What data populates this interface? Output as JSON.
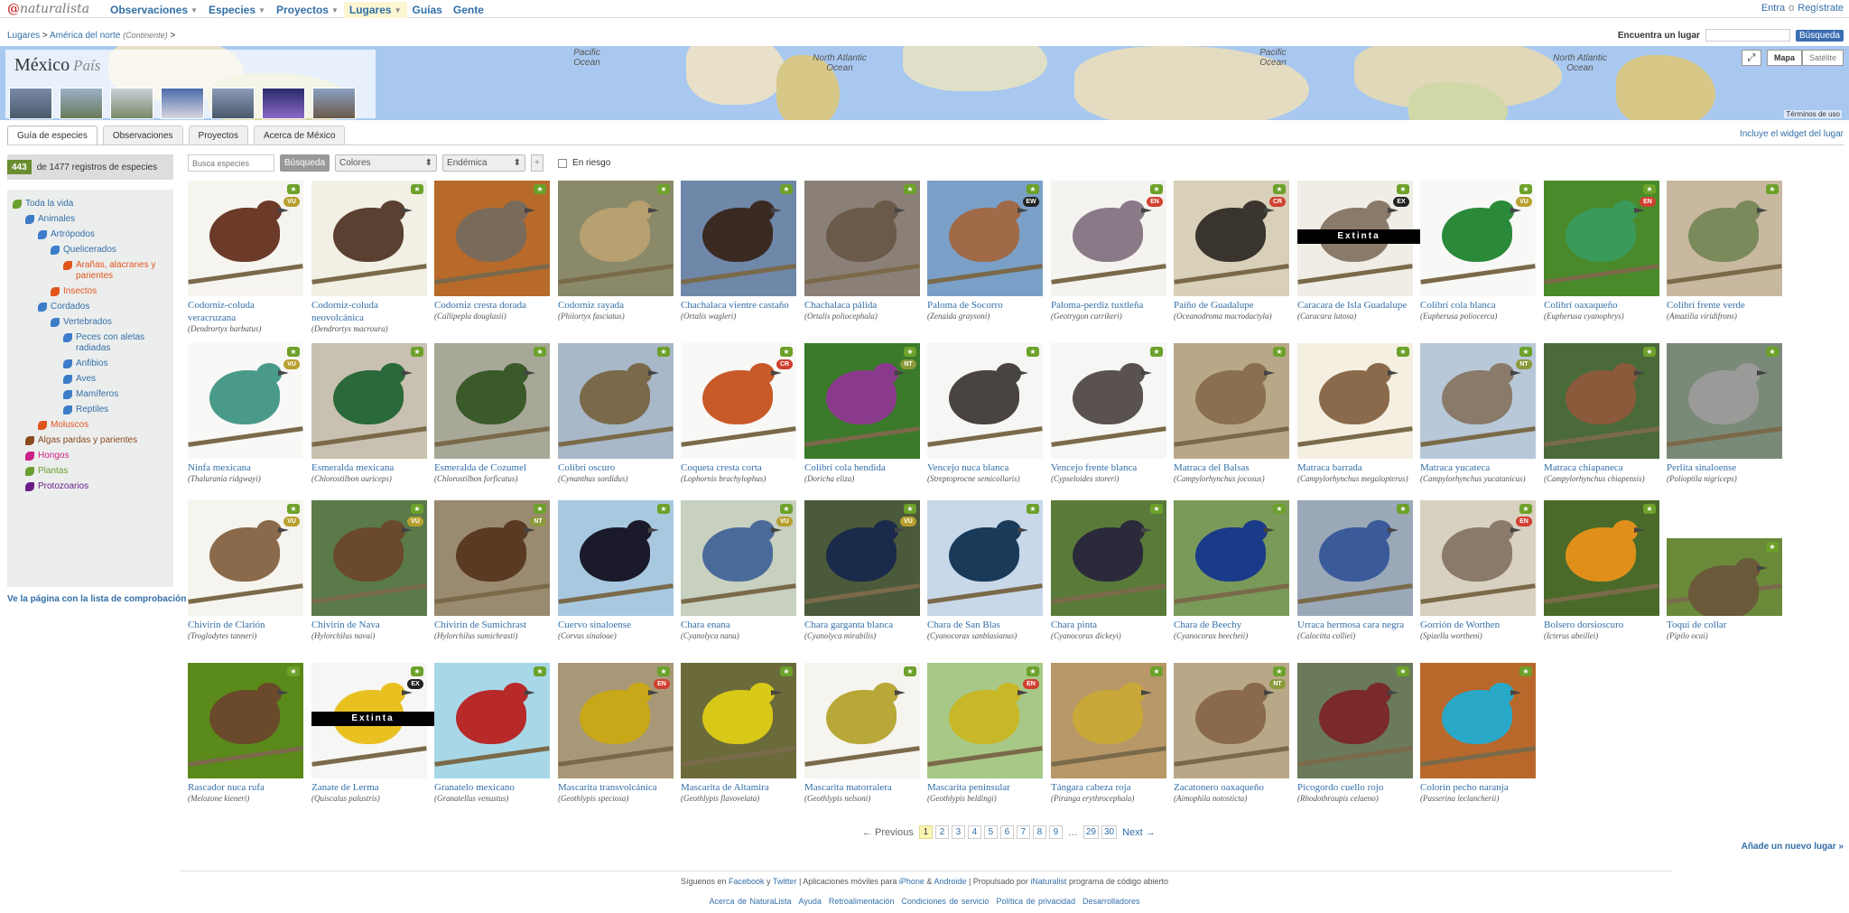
{
  "brand": {
    "logo_text": "naturalista",
    "logo_mark": "@"
  },
  "nav": {
    "items": [
      {
        "label": "Observaciones",
        "dropdown": true
      },
      {
        "label": "Especies",
        "dropdown": true
      },
      {
        "label": "Proyectos",
        "dropdown": true
      },
      {
        "label": "Lugares",
        "dropdown": true,
        "active": true
      },
      {
        "label": "Guías",
        "dropdown": false
      },
      {
        "label": "Gente",
        "dropdown": false
      }
    ]
  },
  "auth": {
    "login": "Entra",
    "or": "o",
    "signup": "Regístrate"
  },
  "breadcrumb": {
    "root": "Lugares",
    "sep": ">",
    "parent": "América del norte",
    "parent_type": "(Continente)"
  },
  "find_place": {
    "label": "Encuentra un lugar",
    "button": "Búsqueda"
  },
  "place": {
    "name": "México",
    "type": "País"
  },
  "map": {
    "oceans": [
      "Pacific Ocean",
      "North Atlantic Ocean",
      "Pacific Ocean",
      "North Atlantic Ocean"
    ],
    "mode_map": "Mapa",
    "mode_sat": "Satélite",
    "terms": "Términos de uso"
  },
  "tabs": [
    "Guía de especies",
    "Observaciones",
    "Proyectos",
    "Acerca de México"
  ],
  "widget_link": "Incluye el widget del lugar",
  "count": {
    "number": "443",
    "text": "de 1477 registros de especies"
  },
  "filters": {
    "search_placeholder": "Busca especies",
    "search_button": "Búsqueda",
    "colors": "Colores",
    "endemic": "Endémica",
    "plus": "+",
    "at_risk": "En riesgo"
  },
  "taxa_tree": [
    {
      "label": "Toda la vida",
      "color": "#6a9e2f",
      "depth": 0
    },
    {
      "label": "Animales",
      "color": "#3d7cc9",
      "depth": 1
    },
    {
      "label": "Artrópodos",
      "color": "#3d7cc9",
      "depth": 2
    },
    {
      "label": "Quelicerados",
      "color": "#3d7cc9",
      "depth": 3
    },
    {
      "label": "Arañas, alacranes y parientes",
      "color": "#e0551e",
      "depth": 4
    },
    {
      "label": "Insectos",
      "color": "#e0551e",
      "depth": 3
    },
    {
      "label": "Cordados",
      "color": "#3d7cc9",
      "depth": 2
    },
    {
      "label": "Vertebrados",
      "color": "#3d7cc9",
      "depth": 3
    },
    {
      "label": "Peces con aletas radiadas",
      "color": "#3d7cc9",
      "depth": 4
    },
    {
      "label": "Anfibios",
      "color": "#3d7cc9",
      "depth": 4
    },
    {
      "label": "Aves",
      "color": "#3d7cc9",
      "depth": 4
    },
    {
      "label": "Mamíferos",
      "color": "#3d7cc9",
      "depth": 4
    },
    {
      "label": "Reptiles",
      "color": "#3d7cc9",
      "depth": 4
    },
    {
      "label": "Moluscos",
      "color": "#e0551e",
      "depth": 2
    },
    {
      "label": "Algas pardas y parientes",
      "color": "#8a4a1e",
      "depth": 1
    },
    {
      "label": "Hongos",
      "color": "#cc2288",
      "depth": 1
    },
    {
      "label": "Plantas",
      "color": "#6a9e2f",
      "depth": 1
    },
    {
      "label": "Protozoarios",
      "color": "#6a1e8a",
      "depth": 1
    }
  ],
  "checklist_link": "Ve la página con la lista de comprobación »",
  "species": [
    {
      "common": "Codorniz-coluda veracruzana",
      "sci": "Dendrortyx barbatus",
      "status": "VU",
      "bg": "#f6f4ef",
      "bird": "#6b3a28"
    },
    {
      "common": "Codorniz-coluda neovolcánica",
      "sci": "Dendrortyx macroura",
      "status": "",
      "bg": "#f2efe4",
      "bird": "#5a4030"
    },
    {
      "common": "Codorniz cresta dorada",
      "sci": "Callipepla douglasii",
      "status": "",
      "bg": "#b86a2a",
      "bird": "#7a6a5a"
    },
    {
      "common": "Codorniz rayada",
      "sci": "Philortyx fasciatus",
      "status": "",
      "bg": "#8a8a6a",
      "bird": "#b8a070"
    },
    {
      "common": "Chachalaca vientre castaño",
      "sci": "Ortalis wagleri",
      "status": "",
      "bg": "#6f87a8",
      "bird": "#3a2a22"
    },
    {
      "common": "Chachalaca pálida",
      "sci": "Ortalis poliocephala",
      "status": "",
      "bg": "#8a8078",
      "bird": "#6a5a4a"
    },
    {
      "common": "Paloma de Socorro",
      "sci": "Zenaida graysoni",
      "status": "EW",
      "bg": "#7aa0c8",
      "bird": "#a06a48"
    },
    {
      "common": "Paloma-perdiz tuxtleña",
      "sci": "Geotrygon carrikeri",
      "status": "EN",
      "bg": "#f5f3ef",
      "bird": "#8a7a88"
    },
    {
      "common": "Paíño de Guadalupe",
      "sci": "Oceanodroma macrodactyla",
      "status": "CR",
      "bg": "#d8d0b8",
      "bird": "#3a342e"
    },
    {
      "common": "Caracara de Isla Guadalupe",
      "sci": "Caracara lutosa",
      "status": "EX",
      "bg": "#f0ede6",
      "bird": "#8a7a6a",
      "extinct": true
    },
    {
      "common": "Colibrí cola blanca",
      "sci": "Eupherusa poliocerca",
      "status": "VU",
      "bg": "#f8f8f6",
      "bird": "#2a8a3a"
    },
    {
      "common": "Colibrí oaxaqueño",
      "sci": "Eupherusa cyanophrys",
      "status": "EN",
      "bg": "#4a8a2a",
      "bird": "#3a9a5a"
    },
    {
      "common": "Colibrí frente verde",
      "sci": "Amazilia viridifrons",
      "status": "",
      "bg": "#c8b8a0",
      "bird": "#7a8a5a"
    },
    {
      "common": "Ninfa mexicana",
      "sci": "Thalurania ridgwayi",
      "status": "VU",
      "bg": "#f8f8f6",
      "bird": "#4a9a8a"
    },
    {
      "common": "Esmeralda mexicana",
      "sci": "Chlorostilbon auriceps",
      "status": "",
      "bg": "#c8c0b0",
      "bird": "#2a6a3a"
    },
    {
      "common": "Esmeralda de Cozumel",
      "sci": "Chlorostilbon forficatus",
      "status": "",
      "bg": "#a8a898",
      "bird": "#3a5a2a"
    },
    {
      "common": "Colibrí oscuro",
      "sci": "Cynanthus sordidus",
      "status": "",
      "bg": "#a8b8c8",
      "bird": "#7a6a4a"
    },
    {
      "common": "Coqueta cresta corta",
      "sci": "Lophornis brachylophus",
      "status": "CR",
      "bg": "#f8f8f6",
      "bird": "#c85a2a"
    },
    {
      "common": "Colibrí cola hendida",
      "sci": "Doricha eliza",
      "status": "NT",
      "bg": "#3a7a2a",
      "bird": "#8a3a8a"
    },
    {
      "common": "Vencejo nuca blanca",
      "sci": "Streptoprocne semicollaris",
      "status": "",
      "bg": "#f6f6f4",
      "bird": "#4a4440"
    },
    {
      "common": "Vencejo frente blanca",
      "sci": "Cypseloides storeri",
      "status": "",
      "bg": "#f6f6f4",
      "bird": "#5a5250"
    },
    {
      "common": "Matraca del Balsas",
      "sci": "Campylorhynchus jocosus",
      "status": "",
      "bg": "#b8a888",
      "bird": "#8a7050"
    },
    {
      "common": "Matraca barrada",
      "sci": "Campylorhynchus megalopterus",
      "status": "",
      "bg": "#f4efe0",
      "bird": "#8a6a4a"
    },
    {
      "common": "Matraca yucateca",
      "sci": "Campylorhynchus yucatanicus",
      "status": "NT",
      "bg": "#b8c8d8",
      "bird": "#8a7a6a"
    },
    {
      "common": "Matraca chiapaneca",
      "sci": "Campylorhynchus chiapensis",
      "status": "",
      "bg": "#4a6a3a",
      "bird": "#8a5a3a"
    },
    {
      "common": "Perlita sinaloense",
      "sci": "Polioptila nigriceps",
      "status": "",
      "bg": "#7a8a78",
      "bird": "#9a9a98"
    },
    {
      "common": "Chivirín de Clarión",
      "sci": "Troglodytes tanneri",
      "status": "VU",
      "bg": "#f6f4ef",
      "bird": "#8a6a4a"
    },
    {
      "common": "Chivirín de Nava",
      "sci": "Hylorchilus navai",
      "status": "VU",
      "bg": "#5a7a4a",
      "bird": "#6a4a2a"
    },
    {
      "common": "Chivirín de Sumichrast",
      "sci": "Hylorchilus sumichrasti",
      "status": "NT",
      "bg": "#9a8a70",
      "bird": "#5a3a22"
    },
    {
      "common": "Cuervo sinaloense",
      "sci": "Corvus sinaloae",
      "status": "",
      "bg": "#a8c8e0",
      "bird": "#1a1a2a"
    },
    {
      "common": "Chara enana",
      "sci": "Cyanolyca nana",
      "status": "VU",
      "bg": "#c8d0c0",
      "bird": "#4a6a9a"
    },
    {
      "common": "Chara garganta blanca",
      "sci": "Cyanolyca mirabilis",
      "status": "VU",
      "bg": "#4a5a3a",
      "bird": "#1a2a4a"
    },
    {
      "common": "Chara de San Blas",
      "sci": "Cyanocorax sanblasianus",
      "status": "",
      "bg": "#c8d8e8",
      "bird": "#1a3a5a"
    },
    {
      "common": "Chara pinta",
      "sci": "Cyanocorax dickeyi",
      "status": "",
      "bg": "#5a7a3a",
      "bird": "#2a2a3a"
    },
    {
      "common": "Chara de Beechy",
      "sci": "Cyanocorax beecheii",
      "status": "",
      "bg": "#7a9a5a",
      "bird": "#1a3a8a"
    },
    {
      "common": "Urraca hermosa cara negra",
      "sci": "Calocitta colliei",
      "status": "",
      "bg": "#9aa8b8",
      "bird": "#3a5a9a"
    },
    {
      "common": "Gorrión de Worthen",
      "sci": "Spizella wortheni",
      "status": "EN",
      "bg": "#d8d0c0",
      "bird": "#8a7a6a"
    },
    {
      "common": "Bolsero dorsioscuro",
      "sci": "Icterus abeillei",
      "status": "",
      "bg": "#4a6a2a",
      "bird": "#e0901a"
    },
    {
      "common": "Toquí de collar",
      "sci": "Pipilo ocai",
      "status": "",
      "bg": "#6a8a3a",
      "bird": "#6a5a3a",
      "short": true
    },
    {
      "common": "Rascador nuca rufa",
      "sci": "Melozone kieneri",
      "status": "",
      "bg": "#5a8a1a",
      "bird": "#6a4a2a"
    },
    {
      "common": "Zanate de Lerma",
      "sci": "Quiscalus palustris",
      "status": "EX",
      "bg": "#f6f6f4",
      "bird": "#e8c020",
      "extinct": true
    },
    {
      "common": "Granatelo mexicano",
      "sci": "Granatellus venustus",
      "status": "",
      "bg": "#a8d8e8",
      "bird": "#b82a2a"
    },
    {
      "common": "Mascarita transvolcánica",
      "sci": "Geothlypis speciosa",
      "status": "EN",
      "bg": "#a89878",
      "bird": "#c8a818"
    },
    {
      "common": "Mascarita de Altamira",
      "sci": "Geothlypis flavovelata",
      "status": "",
      "bg": "#6a6a3a",
      "bird": "#d8c818"
    },
    {
      "common": "Mascarita matorralera",
      "sci": "Geothlypis nelsoni",
      "status": "",
      "bg": "#f6f4ee",
      "bird": "#b8a838"
    },
    {
      "common": "Mascarita peninsular",
      "sci": "Geothlypis beldingi",
      "status": "EN",
      "bg": "#a8c888",
      "bird": "#c8b828"
    },
    {
      "common": "Tángara cabeza roja",
      "sci": "Piranga erythrocephala",
      "status": "",
      "bg": "#b89868",
      "bird": "#c8a838"
    },
    {
      "common": "Zacatonero oaxaqueño",
      "sci": "Aimophila notosticta",
      "status": "NT",
      "bg": "#b8a888",
      "bird": "#8a6a4a"
    },
    {
      "common": "Picogordo cuello rojo",
      "sci": "Rhodothraupis celaeno",
      "status": "",
      "bg": "#6a7a5a",
      "bird": "#7a2a2a"
    },
    {
      "common": "Colorín pecho naranja",
      "sci": "Passerina leclancherii",
      "status": "",
      "bg": "#b8682a",
      "bird": "#2aa8c8"
    }
  ],
  "extinct_label": "Extinta",
  "status_colors": {
    "VU": "#b8a030",
    "EN": "#d04030",
    "CR": "#d04030",
    "EW": "#222222",
    "EX": "#222222",
    "NT": "#8a9a3a"
  },
  "pager": {
    "prev": "← Previous",
    "pages": [
      "1",
      "2",
      "3",
      "4",
      "5",
      "6",
      "7",
      "8",
      "9"
    ],
    "ellipsis": "…",
    "last_pages": [
      "29",
      "30"
    ],
    "next": "Next →"
  },
  "add_place": "Añade un nuevo lugar »",
  "footer": {
    "line1_a": "Síguenos en",
    "facebook": "Facebook",
    "y": "y",
    "twitter": "Twitter",
    "apps": "| Aplicaciones móviles para",
    "iphone": "iPhone",
    "amp": "&",
    "android": "Androide",
    "powered": "| Propulsado por",
    "inat": "iNaturalist",
    "open": "programa de código abierto",
    "links": [
      "Acerca de NaturaLista",
      "Ayuda",
      "Retroalimentación",
      "Condiciones de servicio",
      "Política de privacidad",
      "Desarrolladores"
    ]
  }
}
